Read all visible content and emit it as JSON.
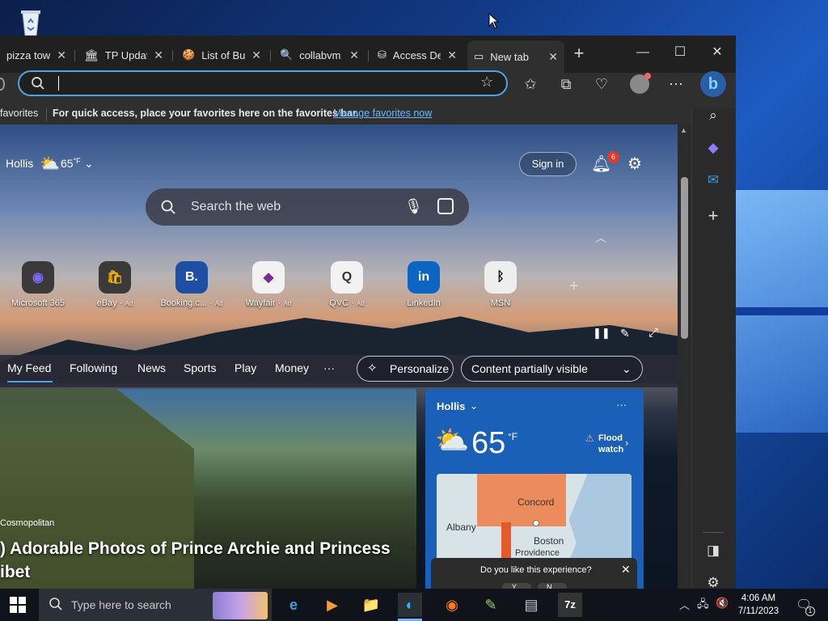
{
  "tabs": [
    {
      "title": "pizza towe"
    },
    {
      "title": "TP Update"
    },
    {
      "title": "List of Buil"
    },
    {
      "title": "collabvm r"
    },
    {
      "title": "Access De"
    },
    {
      "title": "New tab"
    }
  ],
  "favorites_bar": {
    "label": "favorites",
    "message": "For quick access, place your favorites here on the favorites bar.",
    "link": "Manage favorites now"
  },
  "weather_top": {
    "location": "Hollis",
    "temp": "65",
    "unit": "°F"
  },
  "header": {
    "signin": "Sign in",
    "notifications_count": "6"
  },
  "search": {
    "placeholder": "Search the web"
  },
  "quick_links": [
    {
      "label": "Microsoft 365",
      "ad": ""
    },
    {
      "label": "eBay",
      "ad": "Ad"
    },
    {
      "label": "Booking.c...",
      "ad": "Ad"
    },
    {
      "label": "Wayfair",
      "ad": "Ad"
    },
    {
      "label": "QVC",
      "ad": "Ad"
    },
    {
      "label": "LinkedIn",
      "ad": ""
    },
    {
      "label": "MSN",
      "ad": ""
    }
  ],
  "feed_nav": {
    "items": [
      "My Feed",
      "Following",
      "News",
      "Sports",
      "Play",
      "Money"
    ],
    "more": "···",
    "personalize": "Personalize",
    "content_visibility": "Content partially visible"
  },
  "main_card": {
    "source": "Cosmopolitan",
    "headline_line1": ") Adorable Photos of Prince Archie and Princess",
    "headline_line2": "ibet"
  },
  "weather_card": {
    "location": "Hollis",
    "temp": "65",
    "unit": "°F",
    "alert_line1": "Flood",
    "alert_line2": "watch",
    "map_labels": [
      "Concord",
      "Albany",
      "Boston",
      "Providence"
    ]
  },
  "feedback": {
    "question": "Do you like this experience?",
    "yes": "Y...",
    "no": "N..."
  },
  "taskbar": {
    "search_placeholder": "Type here to search",
    "time": "4:06 AM",
    "date": "7/11/2023",
    "notification_count": "1"
  }
}
